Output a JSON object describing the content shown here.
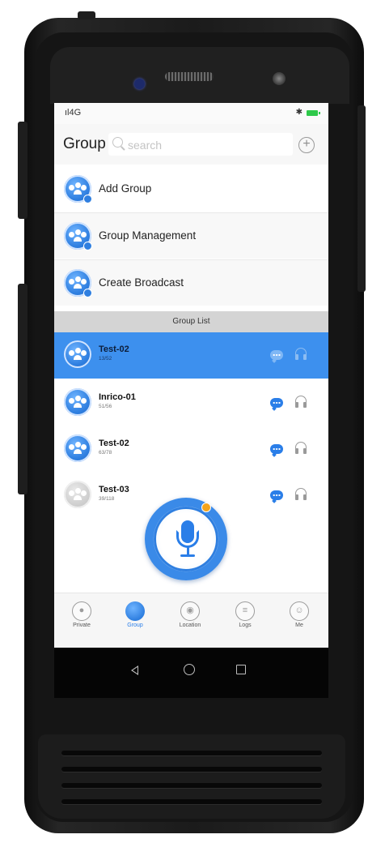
{
  "status_bar": {
    "signal": "ıl4G",
    "bluetooth": "✱"
  },
  "header": {
    "title": "Group",
    "search_placeholder": "search",
    "add_symbol": "+"
  },
  "menu": [
    {
      "label": "Add Group"
    },
    {
      "label": "Group Management"
    },
    {
      "label": "Create Broadcast"
    }
  ],
  "group_list": {
    "header": "Group List",
    "groups": [
      {
        "name": "Test-02",
        "count": "13/52",
        "selected": true
      },
      {
        "name": "Inrico-01",
        "count": "51/56",
        "selected": false
      },
      {
        "name": "Test-02",
        "count": "63/78",
        "selected": false
      },
      {
        "name": "Test-03",
        "count": "39/118",
        "selected": false
      }
    ]
  },
  "tabs": [
    {
      "label": "Private",
      "icon": "person-icon"
    },
    {
      "label": "Group",
      "icon": "group-icon",
      "active": true
    },
    {
      "label": "Location",
      "icon": "location-icon"
    },
    {
      "label": "Logs",
      "icon": "logs-icon"
    },
    {
      "label": "Me",
      "icon": "me-icon"
    }
  ],
  "colors": {
    "accent": "#3d90ee",
    "selected_row": "#3d90ee",
    "group_list_header": "#d4d4d4",
    "battery": "#2ec94a"
  }
}
